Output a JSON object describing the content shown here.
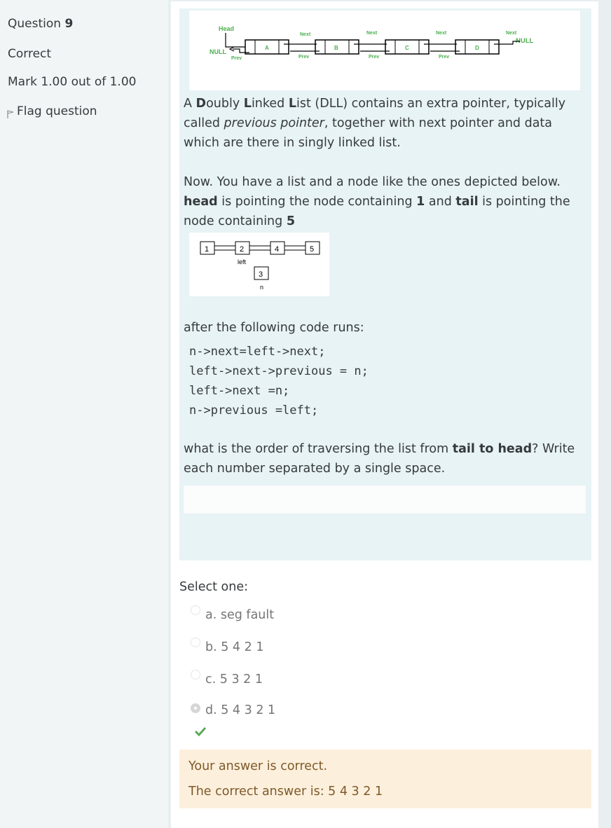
{
  "info": {
    "question_prefix": "Question",
    "question_number": "9",
    "state": "Correct",
    "grade": "Mark 1.00 out of 1.00",
    "flag_label": "Flag question"
  },
  "dll_figure": {
    "head_label": "Head",
    "null_left": "NULL",
    "null_right": "NULL",
    "next_label": "Next",
    "prev_label": "Prev",
    "nodes": [
      "A",
      "B",
      "C",
      "D"
    ]
  },
  "paragraph1": {
    "part1": "A ",
    "b1": "D",
    "part2": "oubly ",
    "b2": "L",
    "part3": "inked ",
    "b3": "L",
    "part4": "ist (DLL) contains an extra pointer, typically called ",
    "italic": "previous pointer",
    "part5": ", together with next pointer and data which are there in singly linked list."
  },
  "paragraph2": {
    "part1": "Now. You have a list and a node like the ones depicted below. ",
    "b_head": "head",
    "part2": " is pointing the node containing ",
    "b_one": "1",
    "part3": " and ",
    "b_tail": "tail",
    "part4": " is pointing the node containing ",
    "b_five": "5"
  },
  "list_figure": {
    "nodes": [
      "1",
      "2",
      "4",
      "5"
    ],
    "left_label": "left",
    "new_node": "3",
    "new_node_label": "n"
  },
  "paragraph3": "after the following code runs:",
  "code_lines": [
    "n->next=left->next;",
    "left->next->previous = n;",
    "left->next =n;",
    "n->previous =left;"
  ],
  "paragraph4": {
    "part1": "what is the order of  traversing the list from ",
    "bold": "tail to head",
    "part2": "? Write each number  separated by a single space."
  },
  "select_one": "Select one:",
  "options": [
    {
      "label": "a. seg fault",
      "selected": false
    },
    {
      "label": "b. 5 4 2 1",
      "selected": false
    },
    {
      "label": "c. 5 3 2 1",
      "selected": false
    },
    {
      "label": "d. 5 4 3 2 1",
      "selected": true
    }
  ],
  "feedback": {
    "line1": "Your answer is correct.",
    "line2": "The correct answer is: 5 4 3 2 1"
  },
  "colors": {
    "check": "#5aab5a",
    "feedback_bg": "#fcefdc",
    "feedback_text": "#7d5a29",
    "question_bg": "#e7f3f5",
    "diagram_green": "#4caf50"
  }
}
